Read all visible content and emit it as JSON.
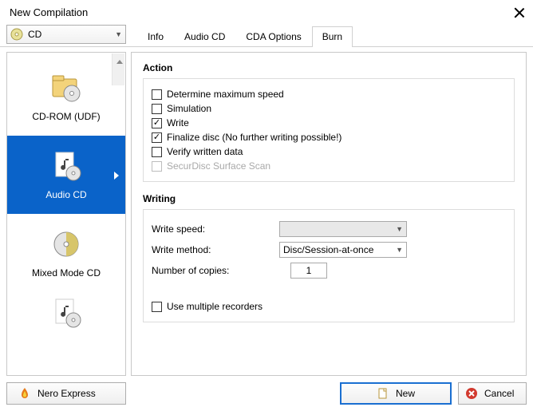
{
  "window": {
    "title": "New Compilation"
  },
  "disc_selector": {
    "label": "CD"
  },
  "tabs": [
    "Info",
    "Audio CD",
    "CDA Options",
    "Burn"
  ],
  "active_tab": "Burn",
  "sidebar": {
    "items": [
      {
        "label": "CD-ROM (UDF)"
      },
      {
        "label": "Audio CD"
      },
      {
        "label": "Mixed Mode CD"
      },
      {
        "label": ""
      }
    ],
    "selected_index": 1
  },
  "sections": {
    "action": {
      "title": "Action",
      "options": [
        {
          "label": "Determine maximum speed",
          "checked": false,
          "disabled": false
        },
        {
          "label": "Simulation",
          "checked": false,
          "disabled": false
        },
        {
          "label": "Write",
          "checked": true,
          "disabled": false
        },
        {
          "label": "Finalize disc (No further writing possible!)",
          "checked": true,
          "disabled": false
        },
        {
          "label": "Verify written data",
          "checked": false,
          "disabled": false
        },
        {
          "label": "SecurDisc Surface Scan",
          "checked": false,
          "disabled": true
        }
      ]
    },
    "writing": {
      "title": "Writing",
      "speed_label": "Write speed:",
      "speed_value": "",
      "method_label": "Write method:",
      "method_value": "Disc/Session-at-once",
      "copies_label": "Number of copies:",
      "copies_value": "1",
      "multi_label": "Use multiple recorders",
      "multi_checked": false
    }
  },
  "buttons": {
    "nero_express": "Nero Express",
    "new": "New",
    "cancel": "Cancel"
  }
}
